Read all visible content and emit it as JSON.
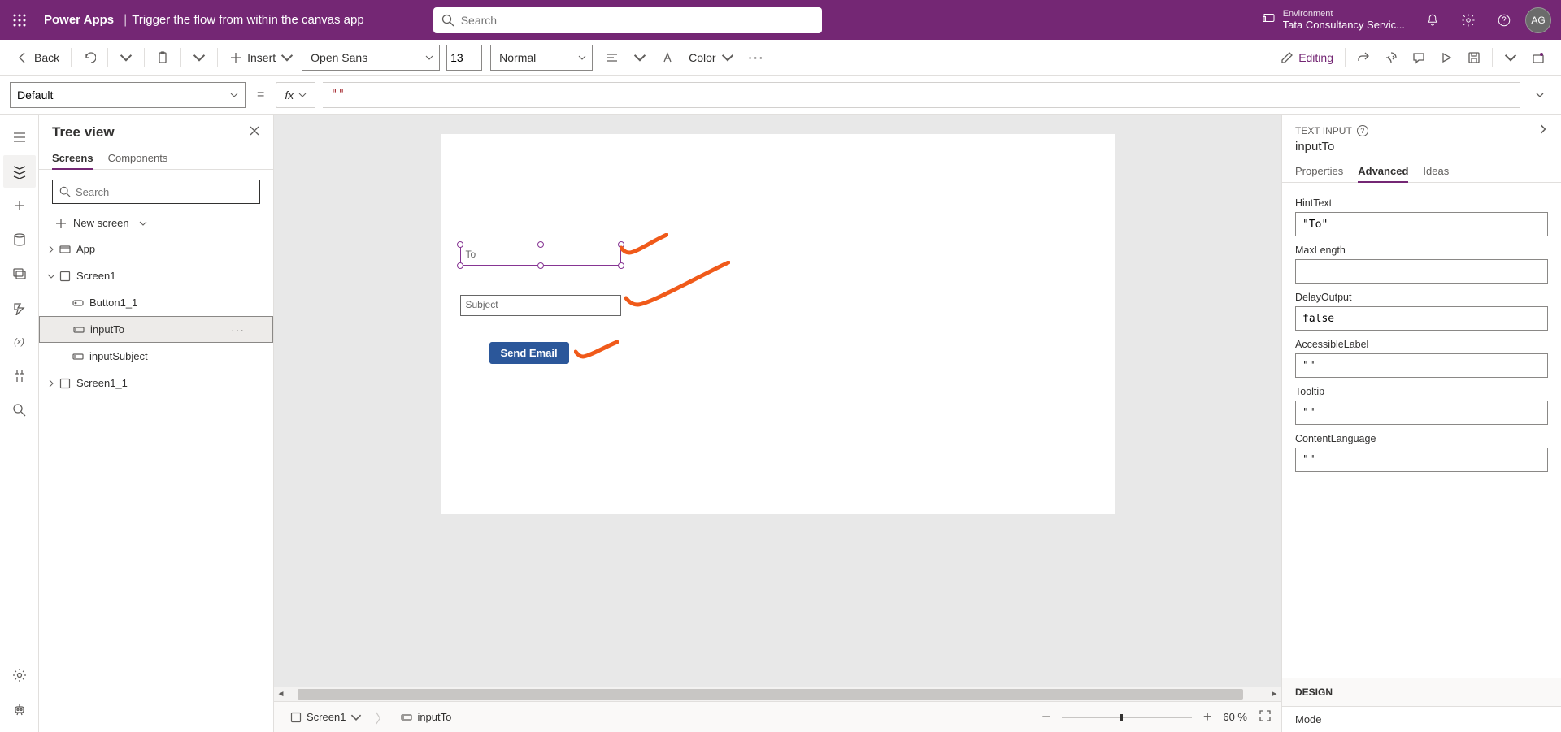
{
  "header": {
    "product": "Power Apps",
    "separator": "|",
    "filename": "Trigger the flow from within the canvas app",
    "search_placeholder": "Search",
    "env_label": "Environment",
    "env_name": "Tata Consultancy Servic...",
    "avatar": "AG"
  },
  "cmd": {
    "back": "Back",
    "insert": "Insert",
    "font": "Open Sans",
    "size": "13",
    "weight": "Normal",
    "color": "Color",
    "editing": "Editing"
  },
  "formula": {
    "prop": "Default",
    "fx": "fx",
    "expr": "\"\""
  },
  "tree": {
    "title": "Tree view",
    "tab_screens": "Screens",
    "tab_components": "Components",
    "search_placeholder": "Search",
    "new_screen": "New screen",
    "nodes": {
      "app": "App",
      "screen1": "Screen1",
      "button1_1": "Button1_1",
      "inputTo": "inputTo",
      "inputSubject": "inputSubject",
      "screen1_1": "Screen1_1"
    }
  },
  "canvas": {
    "to_placeholder": "To",
    "subject_placeholder": "Subject",
    "button_label": "Send Email"
  },
  "footer": {
    "screen": "Screen1",
    "control": "inputTo",
    "zoom": "60  %"
  },
  "props": {
    "type": "TEXT INPUT",
    "name": "inputTo",
    "tab_properties": "Properties",
    "tab_advanced": "Advanced",
    "tab_ideas": "Ideas",
    "HintText_label": "HintText",
    "HintText_value": "\"To\"",
    "MaxLength_label": "MaxLength",
    "MaxLength_value": "",
    "DelayOutput_label": "DelayOutput",
    "DelayOutput_value": "false",
    "AccessibleLabel_label": "AccessibleLabel",
    "AccessibleLabel_value": "\"\"",
    "Tooltip_label": "Tooltip",
    "Tooltip_value": "\"\"",
    "ContentLanguage_label": "ContentLanguage",
    "ContentLanguage_value": "\"\"",
    "design_section": "DESIGN",
    "mode_label": "Mode"
  }
}
